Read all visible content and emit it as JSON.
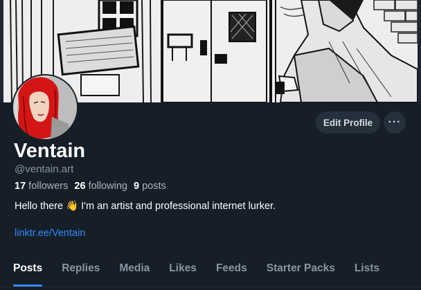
{
  "profile": {
    "display_name": "Ventain",
    "handle": "@ventain.art",
    "followers_count": "17",
    "followers_label": "followers",
    "following_count": "26",
    "following_label": "following",
    "posts_count": "9",
    "posts_label": "posts",
    "bio_prefix": "Hello there",
    "bio_emoji": "👋",
    "bio_suffix": "I'm an artist and professional internet lurker.",
    "link": "linktr.ee/Ventain"
  },
  "actions": {
    "edit_profile": "Edit Profile",
    "more": "···"
  },
  "tabs": [
    {
      "label": "Posts",
      "active": true
    },
    {
      "label": "Replies"
    },
    {
      "label": "Media"
    },
    {
      "label": "Likes"
    },
    {
      "label": "Feeds"
    },
    {
      "label": "Starter Packs"
    },
    {
      "label": "Lists"
    }
  ],
  "colors": {
    "background": "#161e27",
    "accent": "#2f8cff",
    "button_bg": "#26303c",
    "muted_text": "#8995a3"
  },
  "icons": {
    "more": "ellipsis-icon"
  }
}
